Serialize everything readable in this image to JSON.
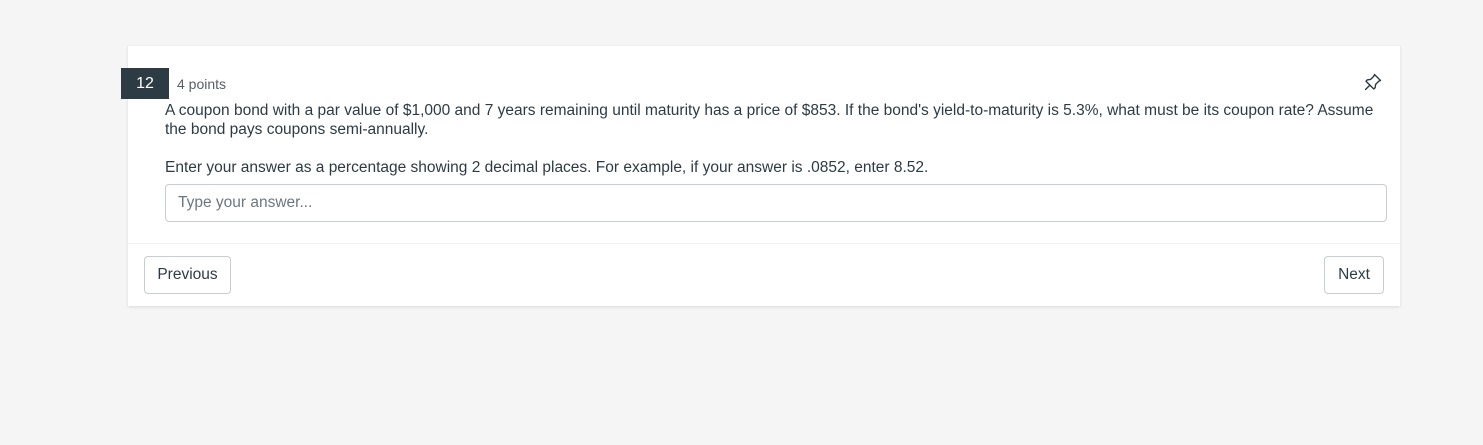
{
  "question": {
    "number": "12",
    "points": "4 points",
    "text": "A coupon bond with a par value of $1,000 and 7 years remaining until maturity has a price of $853. If the bond's yield-to-maturity is 5.3%, what must be its coupon rate? Assume the bond pays coupons semi-annually.",
    "instructions": "Enter your answer as a percentage showing 2 decimal places. For example, if your answer is .0852, enter 8.52.",
    "answer_placeholder": "Type your answer...",
    "answer_value": "",
    "pin_icon": "pin-icon"
  },
  "navigation": {
    "previous_label": "Previous",
    "next_label": "Next"
  },
  "colors": {
    "page_background": "#f5f5f5",
    "question_number_background": "#2d3b45",
    "text": "#2d3b45"
  }
}
